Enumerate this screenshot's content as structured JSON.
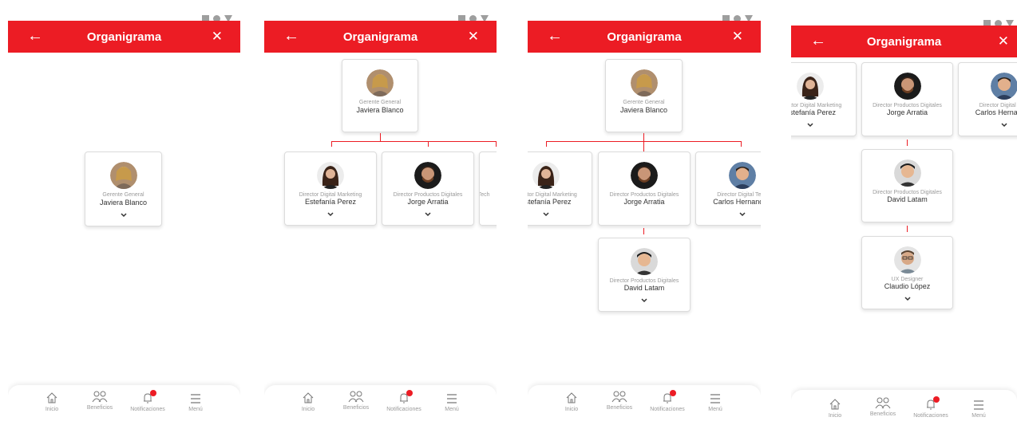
{
  "app": {
    "title": "Organigrama",
    "back_icon": "arrow-left-icon",
    "close_icon": "close-icon",
    "accent_color": "#ec1c24"
  },
  "people": {
    "javiera": {
      "role": "Gerente General",
      "name": "Javiera Blanco"
    },
    "estefania": {
      "role": "Director Digital Marketing",
      "name": "Estefanía Perez"
    },
    "jorge": {
      "role": "Director Productos Digitales",
      "name": "Jorge Arratia"
    },
    "carlos": {
      "role": "Director Digital Tech",
      "name": "Carlos Hernandez"
    },
    "david": {
      "role": "Director Productos Digitales",
      "name": "David Latam"
    },
    "claudio": {
      "role": "UX Designer",
      "name": "Claudio López"
    }
  },
  "nav": {
    "items": [
      {
        "label": "Inicio",
        "icon": "home-icon"
      },
      {
        "label": "Beneficios",
        "icon": "people-icon"
      },
      {
        "label": "Notificaciones",
        "icon": "bell-icon"
      },
      {
        "label": "Menú",
        "icon": "menu-icon"
      }
    ]
  }
}
